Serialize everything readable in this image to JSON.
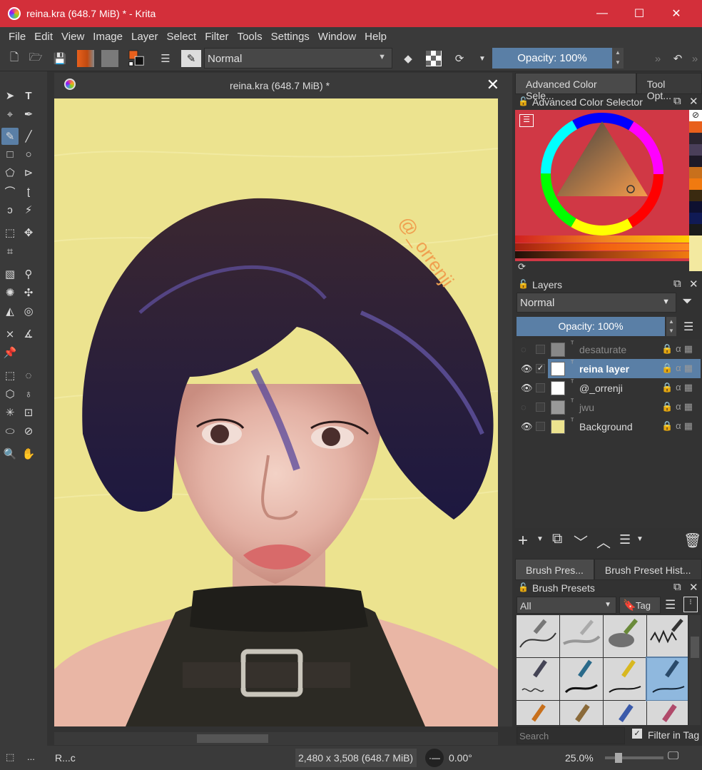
{
  "window": {
    "title": "reina.kra (648.7 MiB) * - Krita",
    "minimize": "—",
    "maximize": "☐",
    "close": "✕"
  },
  "menu": [
    "File",
    "Edit",
    "View",
    "Image",
    "Layer",
    "Select",
    "Filter",
    "Tools",
    "Settings",
    "Window",
    "Help"
  ],
  "toolbar": {
    "blend_mode": "Normal",
    "opacity": "Opacity: 100%"
  },
  "document": {
    "tab_title": "reina.kra (648.7 MiB) *",
    "watermark": "@_orrenji"
  },
  "dockers": {
    "top_tabs": [
      "Advanced Color Sele...",
      "Tool Opt..."
    ],
    "color_selector_title": "Advanced Color Selector",
    "layers_title": "Layers",
    "layers_blend": "Normal",
    "layers_opacity": "Opacity:  100%",
    "layers": [
      {
        "name": "desaturate",
        "visible": false,
        "selected": false,
        "checked": false
      },
      {
        "name": "reina layer",
        "visible": true,
        "selected": true,
        "checked": true
      },
      {
        "name": "@_orrenji",
        "visible": true,
        "selected": false,
        "checked": false
      },
      {
        "name": "jwu",
        "visible": false,
        "selected": false,
        "checked": false
      },
      {
        "name": "Background",
        "visible": true,
        "selected": false,
        "checked": false
      }
    ],
    "brush_tabs": [
      "Brush Pres...",
      "Brush Preset Hist..."
    ],
    "brush_presets_title": "Brush Presets",
    "brush_filter": "All",
    "tag_label": "Tag",
    "search_placeholder": "Search",
    "filter_in_tag": "Filter in Tag"
  },
  "swatch_colors": [
    "#e8601c",
    "#2b2530",
    "#4a3f5a",
    "#1e1a28",
    "#c8701c",
    "#f07a10",
    "#3a2a10",
    "#0e1030",
    "#101a55",
    "#1a1a1a",
    "#f3e9a0",
    "#f3e9a0"
  ],
  "status": {
    "left_text": "R...c",
    "image_size": "2,480 x 3,508 (648.7 MiB)",
    "rotation": "0.00°",
    "zoom": "25.0%"
  },
  "colors": {
    "titlebar": "#d32f3a",
    "accent": "#5a7fa6",
    "canvas_bg": "#ece38f"
  }
}
